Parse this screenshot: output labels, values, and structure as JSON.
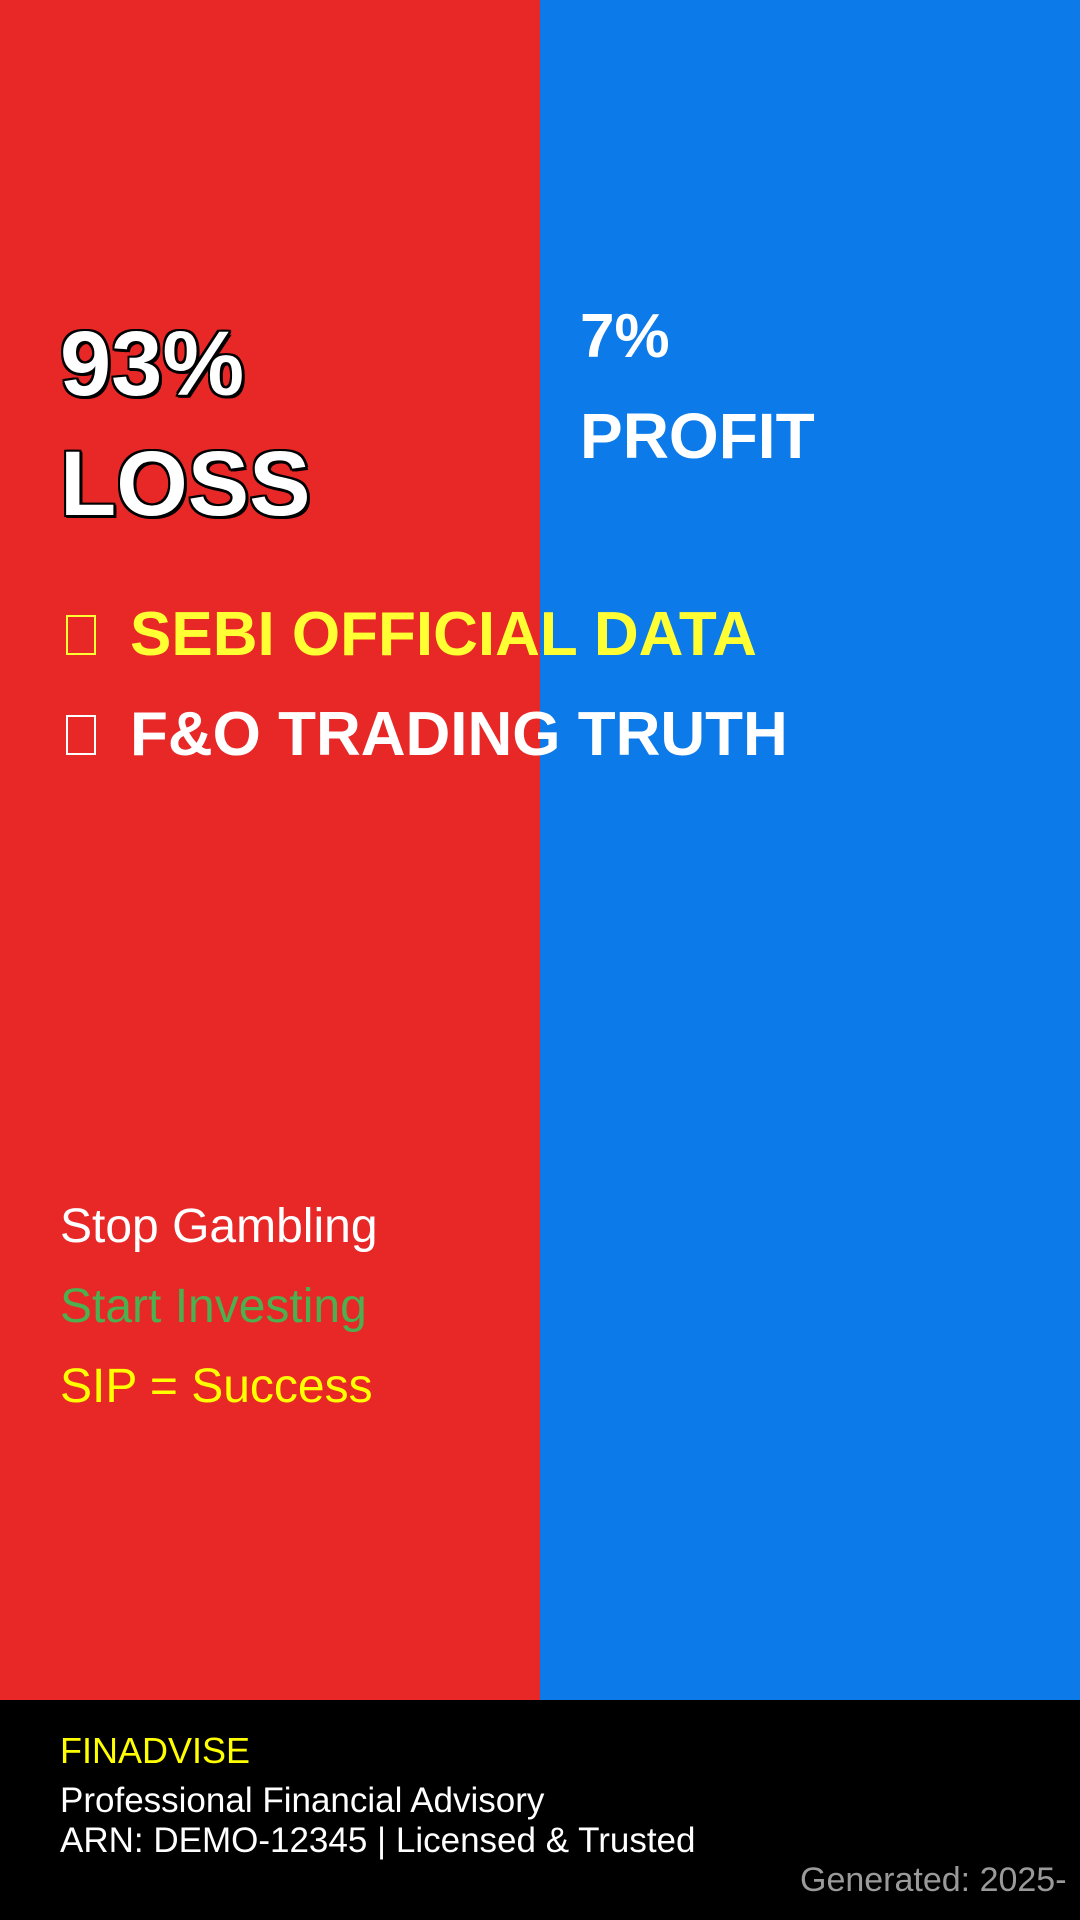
{
  "colors": {
    "loss_panel": "#e82727",
    "profit_panel": "#0c7ae8",
    "footer_bg": "#000000",
    "highlight_yellow": "#ffff33",
    "invest_green": "#4caf50",
    "generated_gray": "#9a9a9a"
  },
  "loss": {
    "percent": "93%",
    "label": "LOSS"
  },
  "profit": {
    "percent": "7%",
    "label": "PROFIT"
  },
  "headlines": [
    {
      "icon": "missing-glyph-icon",
      "text": "SEBI OFFICIAL DATA"
    },
    {
      "icon": "missing-glyph-icon",
      "text": "F&O TRADING TRUTH"
    }
  ],
  "slogans": [
    {
      "text": "Stop Gambling",
      "color": "#ffffff"
    },
    {
      "text": "Start Investing",
      "color": "#4caf50"
    },
    {
      "text": "SIP = Success",
      "color": "#ffff00"
    }
  ],
  "footer": {
    "brand": "FINADVISE",
    "tagline": "Professional Financial Advisory",
    "arn_line": "ARN: DEMO-12345 | Licensed & Trusted",
    "generated": "Generated: 2025-"
  }
}
